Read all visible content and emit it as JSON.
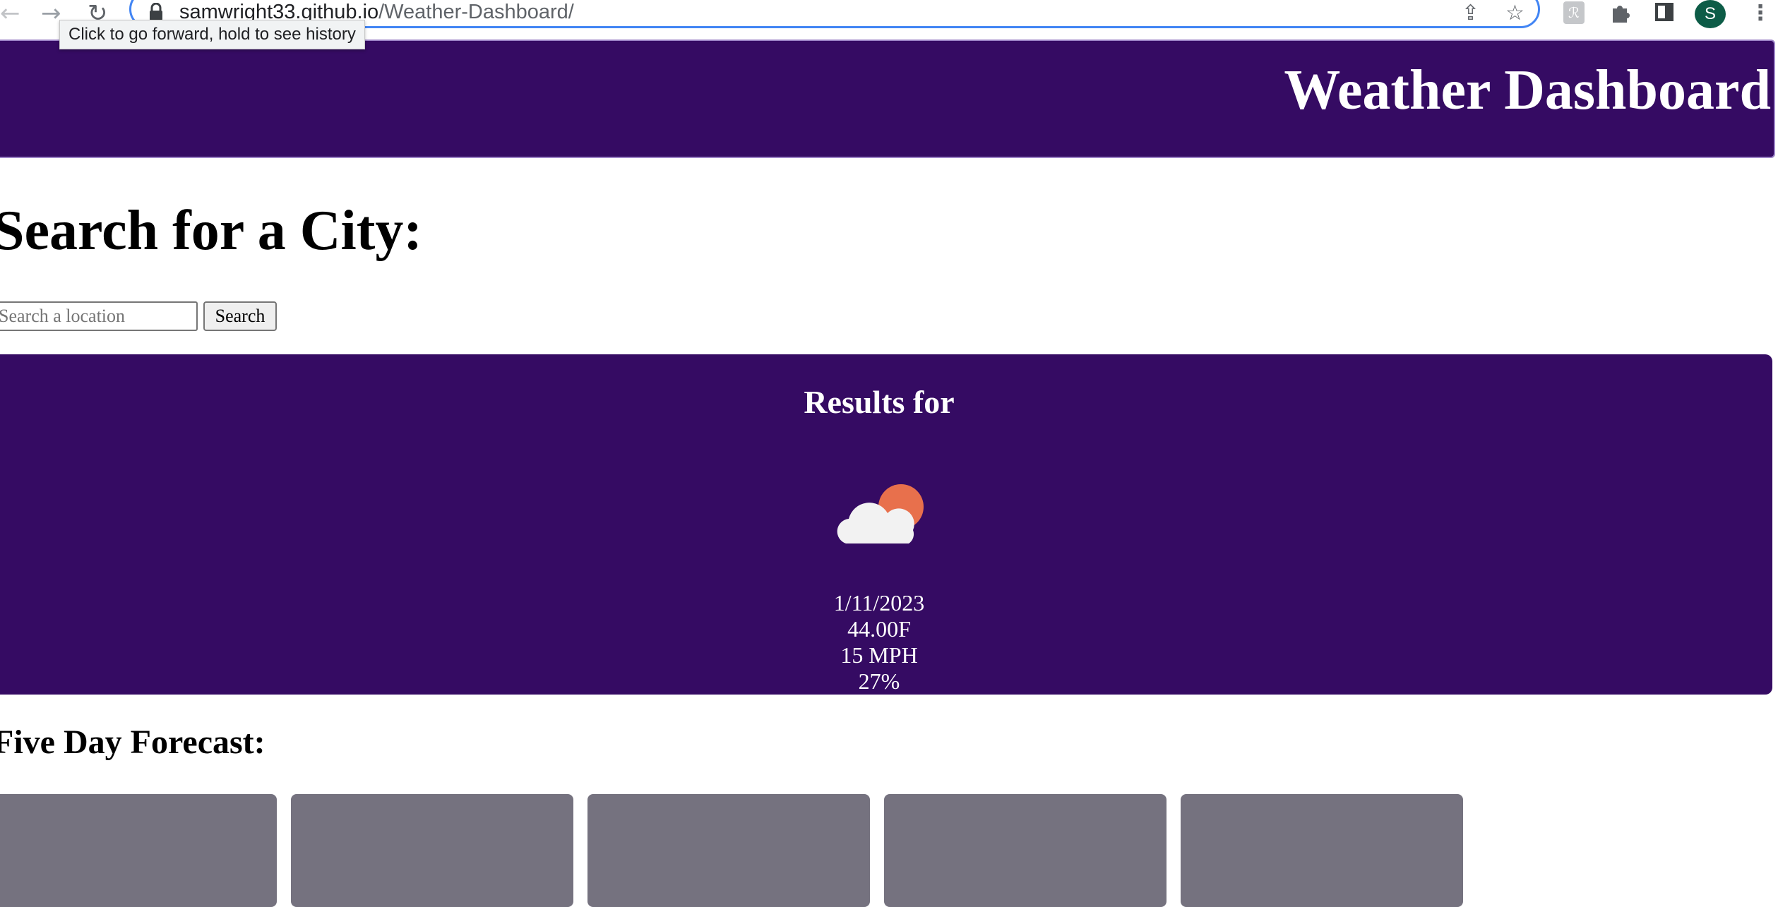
{
  "browser": {
    "url_host": "samwright33.github.io",
    "url_path": "/Weather-Dashboard/",
    "tooltip": "Click to go forward, hold to see history",
    "avatar_initial": "S",
    "icons": {
      "back": "arrow-left-icon",
      "forward": "arrow-right-icon",
      "reload": "reload-icon",
      "lock": "lock-icon",
      "share": "share-icon",
      "bookmark": "star-icon",
      "extension": "extension-icon",
      "extensions_menu": "puzzle-icon",
      "side_panel": "side-panel-icon",
      "menu": "kebab-menu-icon"
    }
  },
  "header": {
    "title": "Weather Dashboard"
  },
  "search": {
    "heading": "Search for a City:",
    "placeholder": "Search a location",
    "value": "",
    "button_label": "Search"
  },
  "results": {
    "title": "Results for",
    "icon": "cloud-sun-icon",
    "date": "1/11/2023",
    "temperature": "44.00F",
    "wind": "15 MPH",
    "humidity": "27%"
  },
  "forecast": {
    "heading": "Five Day Forecast:",
    "cards": [
      {
        "label": ""
      },
      {
        "label": ""
      },
      {
        "label": ""
      },
      {
        "label": ""
      },
      {
        "label": ""
      }
    ]
  },
  "colors": {
    "header_bg": "#350b63",
    "results_bg": "#350b63",
    "forecast_card_bg": "#75727f",
    "sun": "#e8704c",
    "cloud": "#f2f2f2",
    "focus_ring": "#4285f4"
  }
}
